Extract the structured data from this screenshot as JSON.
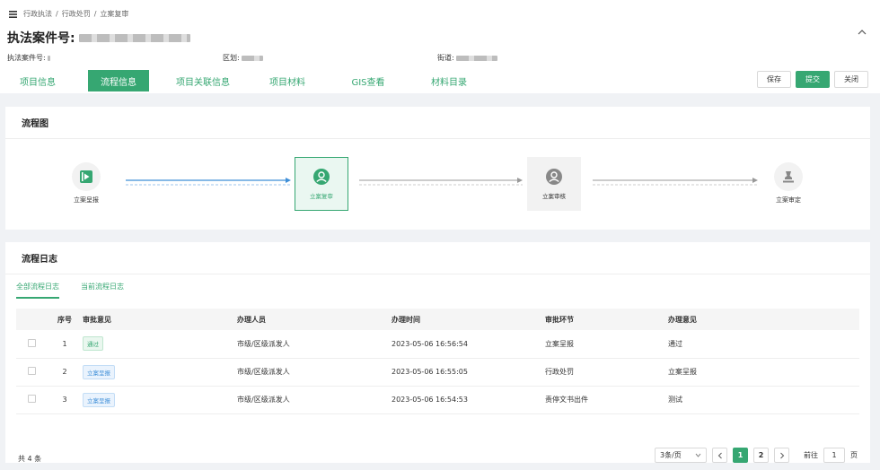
{
  "breadcrumb": [
    "行政执法",
    "行政处罚",
    "立案复审"
  ],
  "breadcrumb_sep": "/",
  "title_label": "执法案件号:",
  "info": {
    "case_no_label": "执法案件号:",
    "district_label": "区划:",
    "street_label": "街道:"
  },
  "tabs": [
    {
      "label": "项目信息",
      "active": false
    },
    {
      "label": "流程信息",
      "active": true
    },
    {
      "label": "项目关联信息",
      "active": false
    },
    {
      "label": "项目材料",
      "active": false
    },
    {
      "label": "GIS查看",
      "active": false
    },
    {
      "label": "材料目录",
      "active": false
    }
  ],
  "actions": {
    "save": "保存",
    "submit": "提交",
    "close": "关闭"
  },
  "flow": {
    "title": "流程图",
    "nodes": [
      "立案呈报",
      "立案复审",
      "立案审核",
      "立案审定"
    ]
  },
  "log": {
    "title": "流程日志",
    "tabs": [
      {
        "label": "全部流程日志",
        "active": true
      },
      {
        "label": "当前流程日志",
        "active": false
      }
    ],
    "columns": [
      "序号",
      "审批意见",
      "办理人员",
      "办理时间",
      "审批环节",
      "办理意见"
    ],
    "rows": [
      {
        "no": "1",
        "opinion": "通过",
        "opinion_type": "green",
        "handler": "市级/区级派发人",
        "time": "2023-05-06 16:56:54",
        "step": "立案呈报",
        "comment": "通过"
      },
      {
        "no": "2",
        "opinion": "立案呈报",
        "opinion_type": "blue",
        "handler": "市级/区级派发人",
        "time": "2023-05-06 16:55:05",
        "step": "行政处罚",
        "comment": "立案呈报"
      },
      {
        "no": "3",
        "opinion": "立案呈报",
        "opinion_type": "blue",
        "handler": "市级/区级派发人",
        "time": "2023-05-06 16:54:53",
        "step": "责停文书出件",
        "comment": "测试"
      }
    ],
    "total": "共 4 条",
    "page_size": "3条/页",
    "pages": [
      "1",
      "2"
    ],
    "current_page": "1",
    "goto_label": "前往",
    "goto_value": "1",
    "page_unit": "页"
  },
  "colors": {
    "accent": "#36a772",
    "blue": "#3f8fd8"
  }
}
